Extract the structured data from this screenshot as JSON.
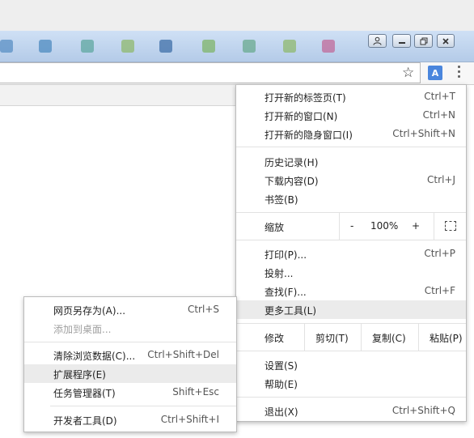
{
  "toolbar": {
    "star_icon": "star-icon",
    "translate_icon": "translate-icon",
    "menu_icon": "menu-dots-icon"
  },
  "main_menu": {
    "new_tab": {
      "label": "打开新的标签页(T)",
      "shortcut": "Ctrl+T"
    },
    "new_window": {
      "label": "打开新的窗口(N)",
      "shortcut": "Ctrl+N"
    },
    "new_incognito": {
      "label": "打开新的隐身窗口(I)",
      "shortcut": "Ctrl+Shift+N"
    },
    "history": {
      "label": "历史记录(H)"
    },
    "downloads": {
      "label": "下载内容(D)",
      "shortcut": "Ctrl+J"
    },
    "bookmarks": {
      "label": "书签(B)"
    },
    "zoom": {
      "label": "缩放",
      "minus": "-",
      "value": "100%",
      "plus": "+"
    },
    "print": {
      "label": "打印(P)...",
      "shortcut": "Ctrl+P"
    },
    "cast": {
      "label": "投射..."
    },
    "find": {
      "label": "查找(F)...",
      "shortcut": "Ctrl+F"
    },
    "more_tools": {
      "label": "更多工具(L)"
    },
    "edit": {
      "label": "修改",
      "cut": "剪切(T)",
      "copy": "复制(C)",
      "paste": "粘贴(P)"
    },
    "settings": {
      "label": "设置(S)"
    },
    "help": {
      "label": "帮助(E)"
    },
    "exit": {
      "label": "退出(X)",
      "shortcut": "Ctrl+Shift+Q"
    }
  },
  "sub_menu": {
    "save_page": {
      "label": "网页另存为(A)...",
      "shortcut": "Ctrl+S"
    },
    "add_to_desktop": {
      "label": "添加到桌面..."
    },
    "clear_data": {
      "label": "清除浏览数据(C)...",
      "shortcut": "Ctrl+Shift+Del"
    },
    "extensions": {
      "label": "扩展程序(E)"
    },
    "task_manager": {
      "label": "任务管理器(T)",
      "shortcut": "Shift+Esc"
    },
    "dev_tools": {
      "label": "开发者工具(D)",
      "shortcut": "Ctrl+Shift+I"
    }
  }
}
